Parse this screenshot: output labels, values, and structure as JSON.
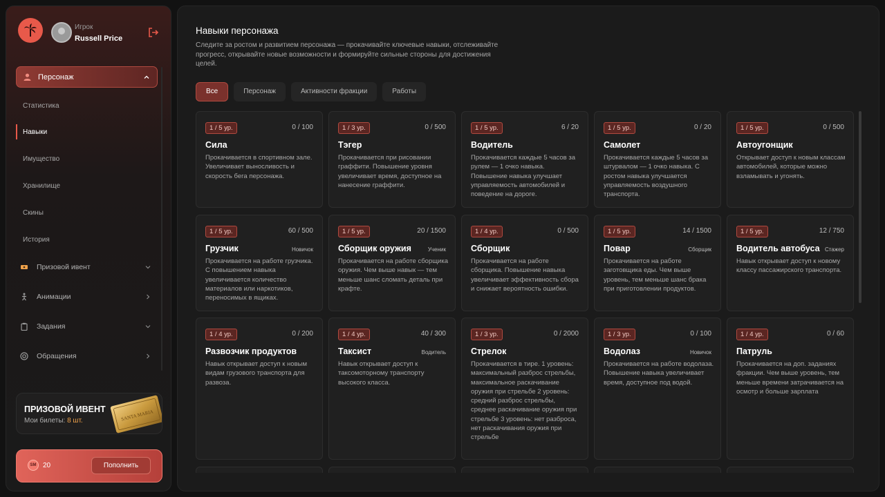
{
  "user": {
    "role": "Игрок",
    "name": "Russell Price"
  },
  "sidebar": {
    "active_section": "Персонаж",
    "sub_items": [
      "Статистика",
      "Навыки",
      "Имущество",
      "Хранилище",
      "Скины",
      "История"
    ],
    "selected_sub": "Навыки",
    "groups": [
      {
        "label": "Призовой ивент",
        "icon": "ticket-icon",
        "arrow": "chevron-down-icon"
      },
      {
        "label": "Анимации",
        "icon": "animation-icon",
        "arrow": "chevron-right-icon"
      },
      {
        "label": "Задания",
        "icon": "clipboard-icon",
        "arrow": "chevron-down-icon"
      },
      {
        "label": "Обращения",
        "icon": "support-icon",
        "arrow": "chevron-right-icon"
      }
    ]
  },
  "prize_event": {
    "title": "ПРИЗОВОЙ ИВЕНТ",
    "tickets_label": "Мои билеты:",
    "tickets_value": "8 шт.",
    "ticket_text": "SANTA MARIA"
  },
  "wallet": {
    "coin": "SM",
    "amount": "20",
    "topup_label": "Пополнить"
  },
  "page": {
    "title": "Навыки персонажа",
    "subtitle": "Следите за ростом и развитием персонажа — прокачивайте ключевые навыки, отслеживайте прогресс, открывайте новые возможности и формируйте сильные стороны для достижения целей."
  },
  "tabs": [
    {
      "label": "Все",
      "active": true
    },
    {
      "label": "Персонаж",
      "active": false
    },
    {
      "label": "Активности фракции",
      "active": false
    },
    {
      "label": "Работы",
      "active": false
    }
  ],
  "skills": [
    {
      "level": "1 / 5 ур.",
      "progress": "0 / 100",
      "name": "Сила",
      "rank": "",
      "desc": "Прокачивается в спортивном зале. Увеличивает выносливость и скорость бега персонажа."
    },
    {
      "level": "1 / 3 ур.",
      "progress": "0 / 500",
      "name": "Тэгер",
      "rank": "",
      "desc": "Прокачивается при рисовании граффити. Повышение уровня увеличивает время, доступное на нанесение граффити."
    },
    {
      "level": "1 / 5 ур.",
      "progress": "6 / 20",
      "name": "Водитель",
      "rank": "",
      "desc": "Прокачивается каждые 5 часов за рулем — 1 очко навыка. Повышение навыка улучшает управляемость автомобилей и поведение на дороге."
    },
    {
      "level": "1 / 5 ур.",
      "progress": "0 / 20",
      "name": "Самолет",
      "rank": "",
      "desc": "Прокачивается каждые 5 часов за штурвалом — 1 очко навыка. С ростом навыка улучшается управляемость воздушного транспорта."
    },
    {
      "level": "1 / 5 ур.",
      "progress": "0 / 500",
      "name": "Автоугонщик",
      "rank": "",
      "desc": "Открывает доступ к новым классам автомобилей, которые можно взламывать и угонять."
    },
    {
      "level": "1 / 5 ур.",
      "progress": "60 / 500",
      "name": "Грузчик",
      "rank": "Новичок",
      "desc": "Прокачивается на работе грузчика. С повышением навыка увеличивается количество материалов или наркотиков, переносимых в ящиках."
    },
    {
      "level": "1 / 5 ур.",
      "progress": "20 / 1500",
      "name": "Сборщик оружия",
      "rank": "Ученик",
      "desc": "Прокачивается на работе сборщика оружия. Чем выше навык — тем меньше шанс сломать деталь при крафте."
    },
    {
      "level": "1 / 4 ур.",
      "progress": "0 / 500",
      "name": "Сборщик",
      "rank": "",
      "desc": "Прокачивается на работе сборщика. Повышение навыка увеличивает эффективность сбора и снижает вероятность ошибки."
    },
    {
      "level": "1 / 5 ур.",
      "progress": "14 / 1500",
      "name": "Повар",
      "rank": "Сборщик",
      "desc": "Прокачивается на работе заготовщика еды. Чем выше уровень, тем меньше шанс брака при приготовлении продуктов."
    },
    {
      "level": "1 / 5 ур.",
      "progress": "12 / 750",
      "name": "Водитель автобуса",
      "rank": "Стажер",
      "desc": "Навык открывает доступ к новому классу пассажирского транспорта."
    },
    {
      "level": "1 / 4 ур.",
      "progress": "0 / 200",
      "name": "Развозчик продуктов",
      "rank": "",
      "desc": "Навык открывает доступ к новым видам грузового транспорта для развоза."
    },
    {
      "level": "1 / 4 ур.",
      "progress": "40 / 300",
      "name": "Таксист",
      "rank": "Водитель",
      "desc": "Навык открывает доступ к таксомоторному транспорту высокого класса."
    },
    {
      "level": "1 / 3 ур.",
      "progress": "0 / 2000",
      "name": "Стрелок",
      "rank": "",
      "desc": "Прокачивается в тире. 1 уровень: максимальный разброс стрельбы, максимальное раскачивание оружия при стрельбе 2 уровень: средний разброс стрельбы, среднее раскачивание оружия при стрельбе 3 уровень: нет разброса, нет раскачивания оружия при стрельбе"
    },
    {
      "level": "1 / 3 ур.",
      "progress": "0 / 100",
      "name": "Водолаз",
      "rank": "Новичок",
      "desc": "Прокачивается на работе водолаза. Повышение навыка увеличивает время, доступное под водой."
    },
    {
      "level": "1 / 4 ур.",
      "progress": "0 / 60",
      "name": "Патруль",
      "rank": "",
      "desc": "Прокачивается на доп. заданиях фракции. Чем выше уровень, тем меньше времени затрачивается на осмотр и больше зарплата"
    }
  ]
}
